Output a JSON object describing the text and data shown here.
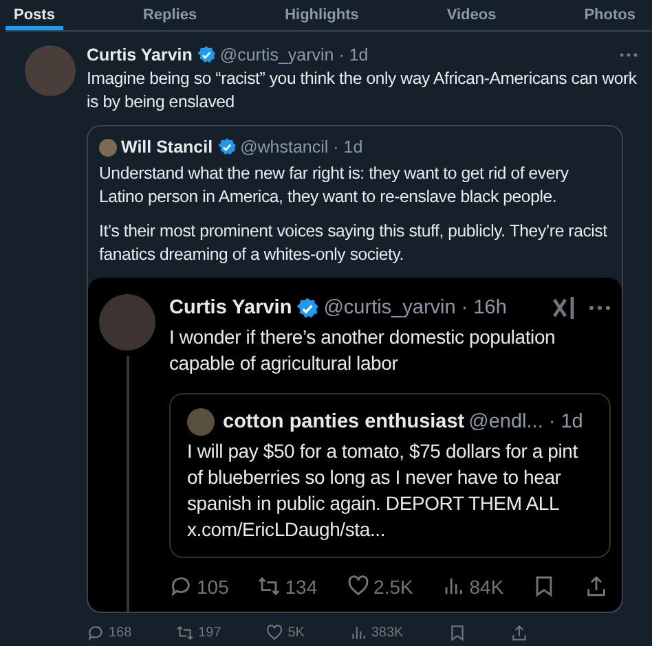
{
  "tabs": [
    {
      "label": "Posts",
      "selected": true
    },
    {
      "label": "Replies",
      "selected": false
    },
    {
      "label": "Highlights",
      "selected": false
    },
    {
      "label": "Videos",
      "selected": false
    },
    {
      "label": "Photos",
      "selected": false
    }
  ],
  "post": {
    "author": "Curtis Yarvin",
    "verified": true,
    "byline": "@curtis_yarvin · 1d",
    "paragraphs": [
      "Imagine being so “racist” you think the only way African-Americans can work is by being enslaved"
    ],
    "quote": {
      "author": "Will Stancil",
      "verified": true,
      "byline": "@whstancil · 1d",
      "paragraphs": [
        "Understand what the new far right is: they want to get rid of every Latino person in America, they want to re-enslave black people.",
        "It’s their most prominent voices saying this stuff, publicly. They’re racist fanatics dreaming of a whites-only society."
      ],
      "screenshot": {
        "author": "Curtis Yarvin",
        "verified": true,
        "byline": "@curtis_yarvin · 16h",
        "paragraphs": [
          "I wonder if there’s another domestic population capable of agricultural labor"
        ],
        "quote": {
          "author": "cotton panties enthusiast",
          "verified": false,
          "byline": "@endl... · 1d",
          "text": "I will pay $50 for a tomato, $75 dollars for a pint of blueberries so long as I never have to hear spanish in public again. DEPORT THEM ALL x.com/EricLDaugh/sta..."
        },
        "stats": [
          {
            "kind": "reply",
            "count": "105"
          },
          {
            "kind": "repost",
            "count": "134"
          },
          {
            "kind": "like",
            "count": "2.5K"
          },
          {
            "kind": "views",
            "count": "84K"
          },
          {
            "kind": "bookmark"
          },
          {
            "kind": "share"
          }
        ]
      }
    },
    "stats": [
      {
        "kind": "reply",
        "count": "168"
      },
      {
        "kind": "repost",
        "count": "197"
      },
      {
        "kind": "like",
        "count": "5K"
      },
      {
        "kind": "views",
        "count": "383K"
      },
      {
        "kind": "bookmark"
      },
      {
        "kind": "share"
      }
    ]
  }
}
